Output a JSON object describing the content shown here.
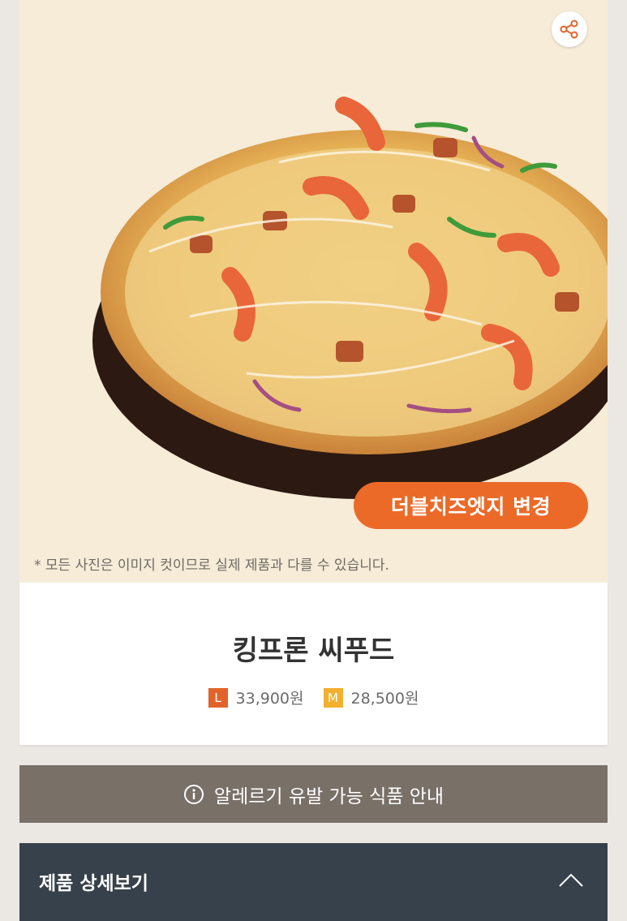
{
  "hero": {
    "share_icon": "share-icon",
    "edge_button_label": "더블치즈엣지 변경",
    "disclaimer": "* 모든 사진은 이미지 컷이므로 실제 제품과 다를 수 있습니다."
  },
  "product": {
    "name": "킹프론 씨푸드",
    "prices": [
      {
        "size": "L",
        "price": "33,900원",
        "color": "#e2632a"
      },
      {
        "size": "M",
        "price": "28,500원",
        "color": "#f3b02f"
      }
    ]
  },
  "allergy": {
    "icon": "info-icon",
    "label": "알레르기 유발 가능 식품 안내"
  },
  "detail": {
    "label": "제품 상세보기",
    "icon": "chevron-up-icon"
  },
  "colors": {
    "accent": "#ec6a28",
    "allergy_bar": "#797068",
    "detail_bar": "#37414b",
    "hero_bg": "#f6ecd8"
  }
}
